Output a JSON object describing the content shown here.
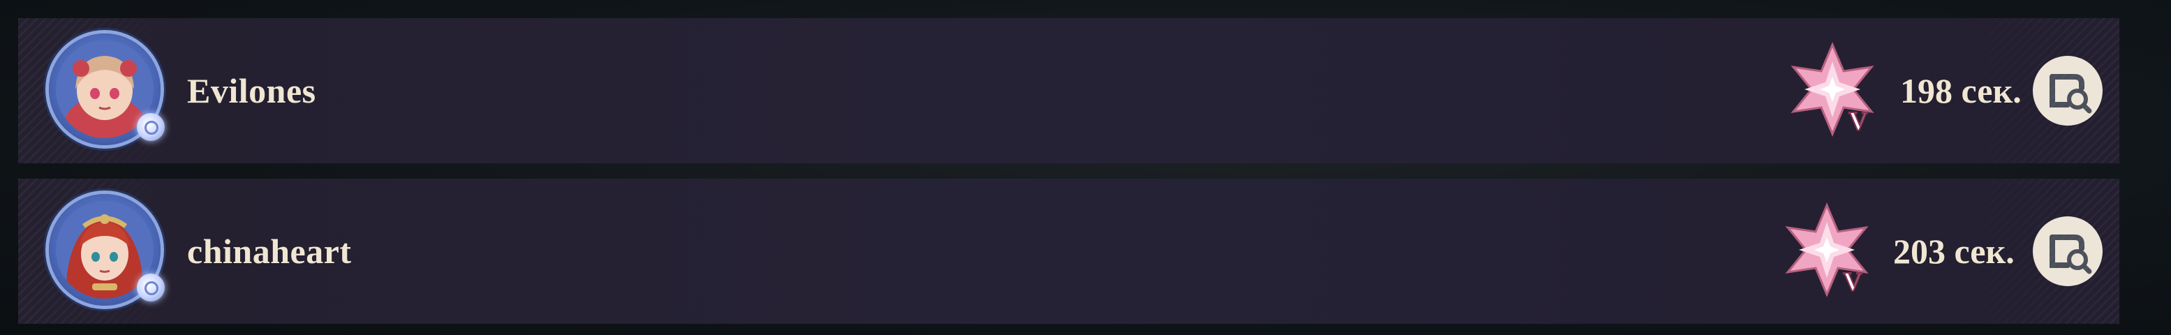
{
  "leaderboard": {
    "entries": [
      {
        "nickname": "Evilones",
        "time": "198 сек.",
        "avatar": "character-portrait-blonde",
        "medal_icon": "pink-diamond-medal-icon",
        "medal_rank": "V",
        "action_icon": "replay-view-icon"
      },
      {
        "nickname": "chinaheart",
        "time": "203 сек.",
        "avatar": "character-portrait-redhead",
        "medal_icon": "pink-diamond-medal-icon",
        "medal_rank": "V",
        "action_icon": "replay-view-icon"
      }
    ]
  },
  "colors": {
    "row_bg": "#262236",
    "text": "#f1e6d2",
    "medal_pink": "#f2a9c4",
    "button_bg": "#ece5d8",
    "button_icon": "#4a4f5a"
  }
}
